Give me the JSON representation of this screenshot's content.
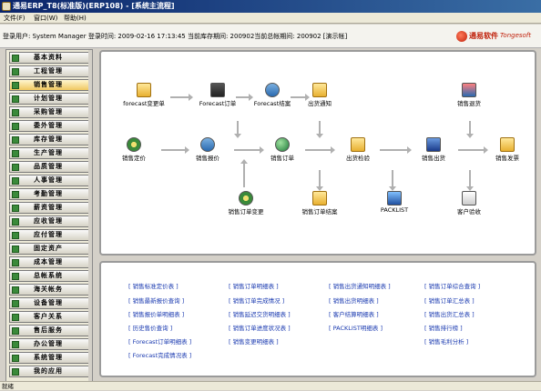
{
  "window": {
    "title": "通易ERP_T8(标准版)(ERP108) - [系统主流程]"
  },
  "menu": [
    "文件(F)",
    "窗口(W)",
    "帮助(H)"
  ],
  "info": {
    "text": "登录用户: System Manager 登录时间: 2009-02-16 17:13:45 当前库存期间: 200902当前总帐期间: 200902 [演示帐]"
  },
  "logo": {
    "cn": "通易软件",
    "en": "Tongesoft"
  },
  "sidebar": [
    {
      "label": "基本资料"
    },
    {
      "label": "工程管理"
    },
    {
      "label": "销售管理"
    },
    {
      "label": "计划管理"
    },
    {
      "label": "采购管理"
    },
    {
      "label": "委外管理"
    },
    {
      "label": "库存管理"
    },
    {
      "label": "生产管理"
    },
    {
      "label": "品质管理"
    },
    {
      "label": "人事管理"
    },
    {
      "label": "考勤管理"
    },
    {
      "label": "薪资管理"
    },
    {
      "label": "应收管理"
    },
    {
      "label": "应付管理"
    },
    {
      "label": "固定资产"
    },
    {
      "label": "成本管理"
    },
    {
      "label": "总帐系统"
    },
    {
      "label": "海关帐务"
    },
    {
      "label": "设备管理"
    },
    {
      "label": "客户关系"
    },
    {
      "label": "售后服务"
    },
    {
      "label": "办公管理"
    },
    {
      "label": "系统管理"
    },
    {
      "label": "我的应用"
    }
  ],
  "flow": {
    "nodes": [
      {
        "label": "forecast变更单"
      },
      {
        "label": "Forecast订单"
      },
      {
        "label": "Forecast结案"
      },
      {
        "label": "出货通知"
      },
      {
        "label": "销售退货"
      },
      {
        "label": "销售定价"
      },
      {
        "label": "销售报价"
      },
      {
        "label": "销售订单"
      },
      {
        "label": "出货检验"
      },
      {
        "label": "销售出货"
      },
      {
        "label": "销售发票"
      },
      {
        "label": "销售订单变更"
      },
      {
        "label": "销售订单结案"
      },
      {
        "label": "PACKLIST"
      },
      {
        "label": "客户验收"
      }
    ]
  },
  "reports": {
    "col1": [
      "销售标准定价表",
      "销售最新报价查询",
      "销售报价单明细表",
      "历史售价查询",
      "Forecast订单明细表",
      "Forecast完成情况表"
    ],
    "col2": [
      "销售订单明细表",
      "销售订单完成情况",
      "销售延迟交货明细表",
      "销售订单进度状况表",
      "销售变更明细表"
    ],
    "col3": [
      "销售出货通知明细表",
      "销售出货明细表",
      "客户结算明细表",
      "PACKLIST明细表"
    ],
    "col4": [
      "销售订单综合查询",
      "销售订单汇总表",
      "销售出货汇总表",
      "销售排行榜",
      "销售毛利分析"
    ]
  },
  "status": {
    "text": "就绪"
  }
}
